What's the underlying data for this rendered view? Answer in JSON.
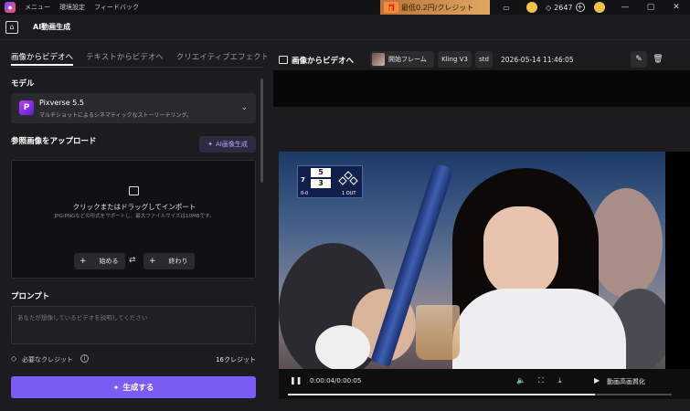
{
  "titlebar": {
    "menu": [
      "メニュー",
      "環境設定",
      "フィードバック"
    ],
    "promo": "最低0.2円/クレジット",
    "gem_count": "2647"
  },
  "nav": {
    "tab": "AI動画生成"
  },
  "left": {
    "tabs": [
      "画像からビデオへ",
      "テキストからビデオへ",
      "クリエイティブエフェクト"
    ],
    "active_tab": 0,
    "model_label": "モデル",
    "model_name": "Pixverse 5.5",
    "model_desc": "マルチショットによるシネマティックなストーリーテリング。",
    "ref_label": "参照画像をアップロード",
    "ai_image_btn": "AI画像生成",
    "upload_title": "クリックまたはドラッグしてインポート",
    "upload_sub": "JPG/PNGなどの形式をサポートし、最大ファイルサイズは10MBです。",
    "start_btn": "始める",
    "end_btn": "終わり",
    "prompt_label": "プロンプト",
    "prompt_placeholder": "あなたが想像しているビデオを説明してください",
    "credits_label": "必要なクレジット",
    "credits_value": "16クレジット",
    "generate_btn": "生成する"
  },
  "right": {
    "title": "画像からビデオへ",
    "chip_frame": "開始フレーム",
    "chip_model": "Kling V3",
    "chip_quality": "std",
    "timestamp": "2026-05-14 11:46:05",
    "time_display": "0:00:04/0:00:05",
    "enhance_label": "動画高画質化",
    "progress": 0.8,
    "scoreboard": {
      "score_top": "5",
      "score_bottom": "3",
      "inning": "7",
      "count": "0-0",
      "outs": "1 OUT"
    }
  },
  "colors": {
    "accent": "#7b5cf5",
    "promo": "#e0a862",
    "panel": "#1c1c1e"
  }
}
